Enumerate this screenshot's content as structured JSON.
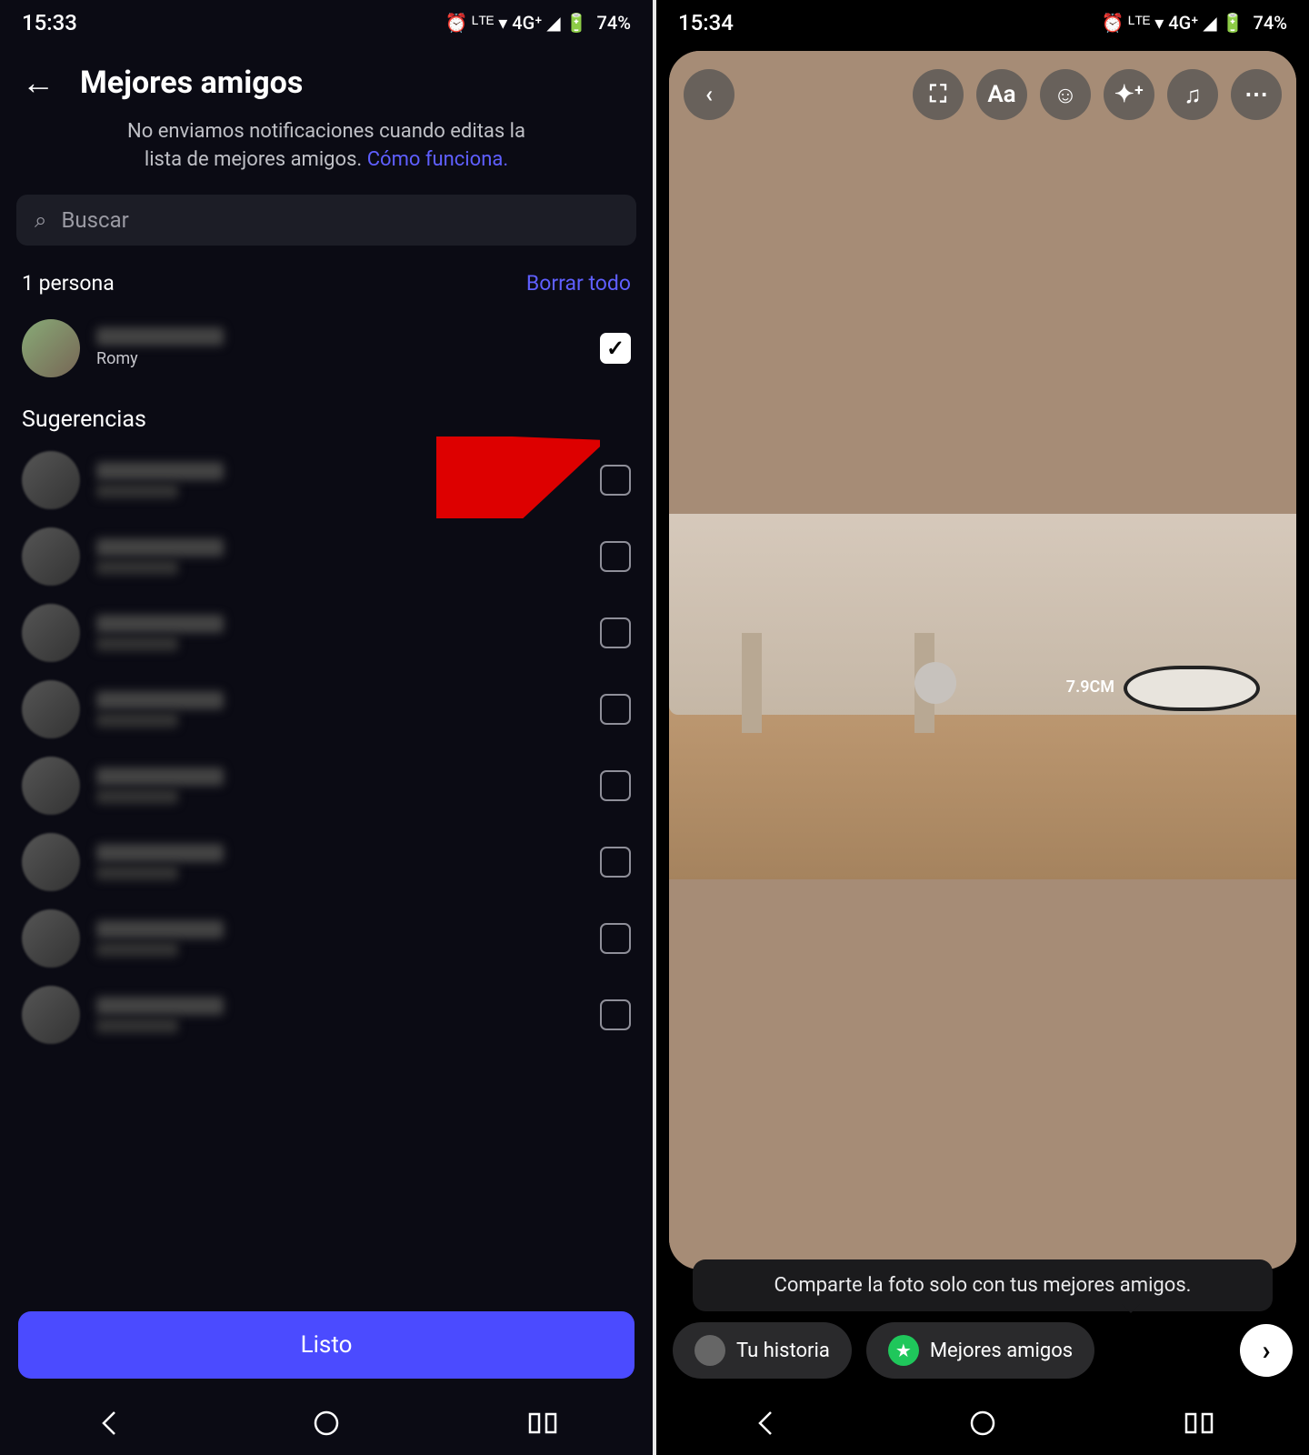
{
  "left": {
    "status": {
      "time": "15:33",
      "battery": "74%",
      "indicators": "⏰ ᴸᵀᴱ ▾ 4G⁺ ◢ 🔋"
    },
    "header": {
      "title": "Mejores amigos"
    },
    "subtext": {
      "line1": "No enviamos notificaciones cuando editas la",
      "line2": "lista de mejores amigos.",
      "link": "Cómo funciona."
    },
    "search": {
      "placeholder": "Buscar"
    },
    "count_label": "1 persona",
    "clear_label": "Borrar todo",
    "selected": {
      "display_name": "",
      "username": "Romy",
      "checked": true
    },
    "suggestions_title": "Sugerencias",
    "suggestions": [
      {
        "checked": false
      },
      {
        "checked": false
      },
      {
        "checked": false
      },
      {
        "checked": false
      },
      {
        "checked": false
      },
      {
        "checked": false
      },
      {
        "checked": false
      },
      {
        "checked": false
      }
    ],
    "done_label": "Listo"
  },
  "right": {
    "status": {
      "time": "15:34",
      "battery": "74%",
      "indicators": "⏰ ᴸᵀᴱ ▾ 4G⁺ ◢ 🔋"
    },
    "toolbar_icons": {
      "back": "‹",
      "fullscreen": "⛶",
      "text": "Aa",
      "sticker": "☺",
      "effects": "✦⁺",
      "music": "♫",
      "more": "⋯"
    },
    "photo": {
      "measurement": "7.9CM"
    },
    "tooltip": "Comparte la foto solo con tus mejores amigos.",
    "share": {
      "your_story": "Tu historia",
      "best_friends": "Mejores amigos"
    }
  },
  "nav": {
    "back": "‹",
    "home": "○",
    "recent": "▭"
  },
  "colors": {
    "accent": "#4b4bff",
    "link": "#5f5fff",
    "green": "#1fc75b"
  }
}
